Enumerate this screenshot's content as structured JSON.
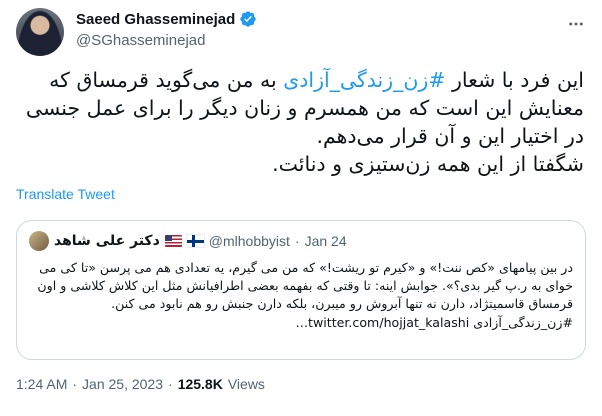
{
  "author": {
    "name": "Saeed Ghasseminejad",
    "handle": "@SGhasseminejad",
    "verified": true
  },
  "tweet": {
    "text_before_hashtag": "این فرد با شعار ",
    "hashtag": "#زن_زندگی_آزادی",
    "text_after_hashtag": " به من می‌گوید قرمساق که معنایش این است که من همسرم و زنان دیگر را برای عمل جنسی در اختیار این و آن قرار می‌دهم.",
    "text_line_2": "شگفتا از این همه زن‌ستیزی و دنائت.",
    "translate_label": "Translate Tweet"
  },
  "quote": {
    "name": "دکتر علی شاهد",
    "handle": "@mlhobbyist",
    "separator": "·",
    "date": "Jan 24",
    "text": "در بین پیامهای «کص ننت!» و «کیرم تو ریشت!» که من می گیرم، یه تعدادی هم می پرسن «تا کی می خوای به ر.پ گیر بدی؟». جوابش اینه: تا وقتی که بفهمه بعضی اطرافیانش مثل این کلاش کلاشی و اون قرمساق قاسمیتژاد، دارن نه تنها آبروش رو میبرن، بلکه دارن جنبش رو هم نابود می کنن.",
    "hashtag_line": "#زن_زندگی_آزادی",
    "link": "twitter.com/hojjat_kalashi…"
  },
  "meta": {
    "time": "1:24 AM",
    "date": "Jan 25, 2023",
    "separator": "·",
    "views_count": "125.8K",
    "views_label": "Views"
  },
  "icons": {
    "verified": "verified-badge-icon",
    "more": "more-dots-icon",
    "flag_us": "us-flag-icon",
    "flag_fi": "finland-flag-icon"
  },
  "colors": {
    "accent": "#1d9bf0",
    "text": "#0f1419",
    "secondary": "#536471",
    "border": "#cfd9de"
  }
}
